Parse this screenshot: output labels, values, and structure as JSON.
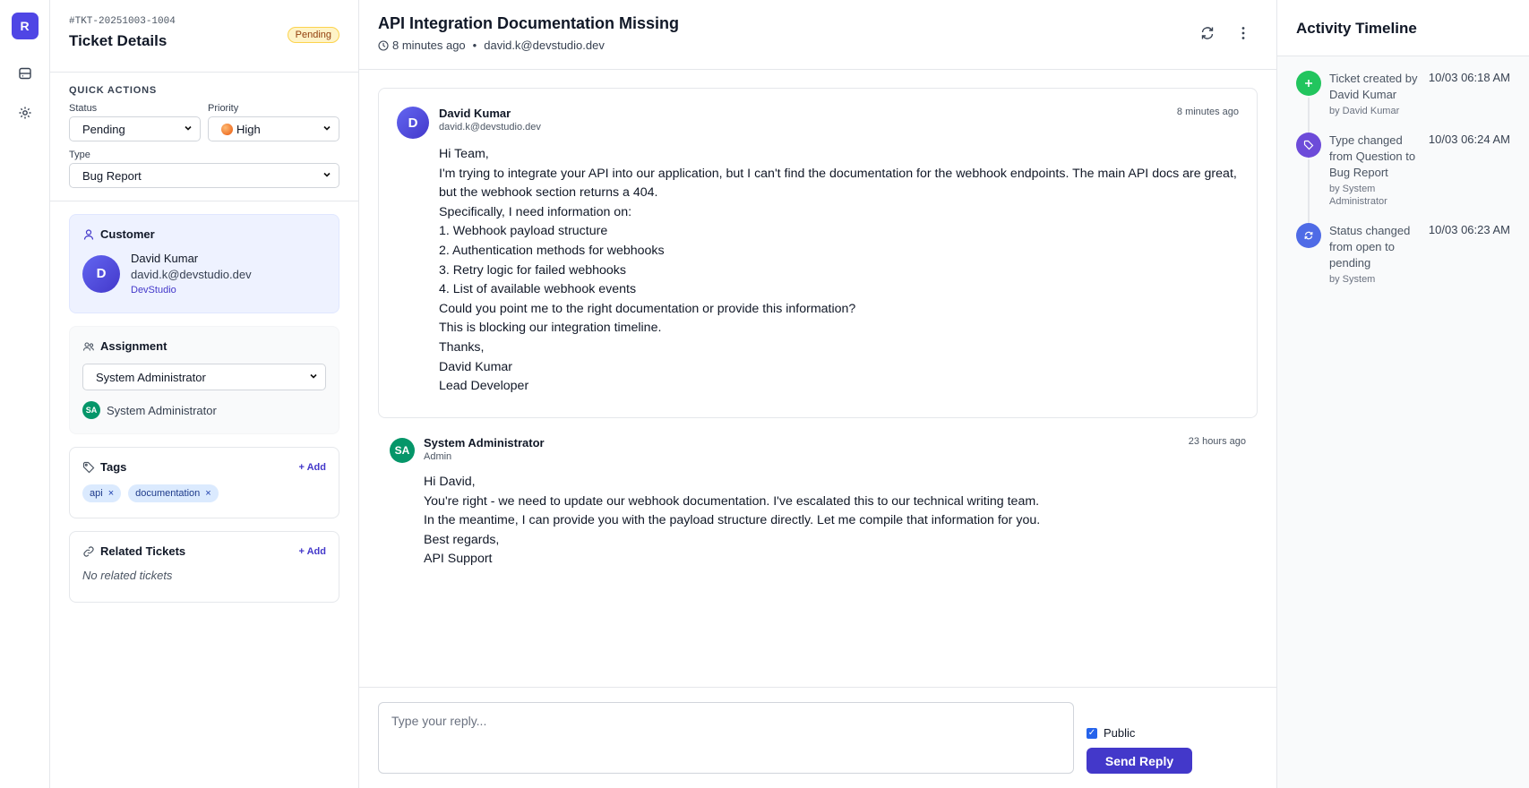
{
  "rail": {
    "logo_letter": "R"
  },
  "details": {
    "ticket_id": "#TKT-20251003-1004",
    "title": "Ticket Details",
    "status_badge": "Pending",
    "quick_actions": {
      "title": "QUICK ACTIONS",
      "status_label": "Status",
      "status_value": "Pending",
      "priority_label": "Priority",
      "priority_value": "High",
      "type_label": "Type",
      "type_value": "Bug Report"
    },
    "customer": {
      "title": "Customer",
      "avatar_letter": "D",
      "name": "David Kumar",
      "email": "david.k@devstudio.dev",
      "company": "DevStudio"
    },
    "assignment": {
      "title": "Assignment",
      "selected": "System Administrator",
      "assignee_initials": "SA",
      "assignee_name": "System Administrator"
    },
    "tags": {
      "title": "Tags",
      "add_label": "+ Add",
      "items": [
        "api",
        "documentation"
      ]
    },
    "related": {
      "title": "Related Tickets",
      "add_label": "+ Add",
      "empty": "No related tickets"
    }
  },
  "main": {
    "title": "API Integration Documentation Missing",
    "meta_time": "8 minutes ago",
    "meta_sep": "•",
    "meta_email": "david.k@devstudio.dev",
    "messages": [
      {
        "avatar": "D",
        "sender": "David Kumar",
        "sub": "david.k@devstudio.dev",
        "time": "8 minutes ago",
        "lines": [
          "Hi Team,",
          "I'm trying to integrate your API into our application, but I can't find the documentation for the webhook endpoints. The main API docs are great, but the webhook section returns a 404.",
          "Specifically, I need information on:",
          "1. Webhook payload structure",
          "2. Authentication methods for webhooks",
          "3. Retry logic for failed webhooks",
          "4. List of available webhook events",
          "Could you point me to the right documentation or provide this information?",
          "This is blocking our integration timeline.",
          "Thanks,",
          "David Kumar",
          "Lead Developer"
        ]
      },
      {
        "avatar": "SA",
        "sender": "System Administrator",
        "sub": "Admin",
        "time": "23 hours ago",
        "lines": [
          "Hi David,",
          "You're right - we need to update our webhook documentation. I've escalated this to our technical writing team.",
          "In the meantime, I can provide you with the payload structure directly. Let me compile that information for you.",
          "Best regards,",
          "API Support"
        ]
      }
    ],
    "reply": {
      "placeholder": "Type your reply...",
      "public_label": "Public",
      "send_label": "Send Reply"
    }
  },
  "timeline": {
    "title": "Activity Timeline",
    "items": [
      {
        "icon": "plus-icon",
        "color": "#22c55e",
        "desc": "Ticket created by David Kumar",
        "by": "by David Kumar",
        "time": "10/03 06:18 AM"
      },
      {
        "icon": "tag-icon",
        "color": "#6d4bd9",
        "desc": "Type changed from Question to Bug Report",
        "by": "by System Administrator",
        "time": "10/03 06:24 AM"
      },
      {
        "icon": "refresh-icon",
        "color": "#4f6be6",
        "desc": "Status changed from open to pending",
        "by": "by System",
        "time": "10/03 06:23 AM"
      }
    ]
  },
  "colors": {
    "brand": "#4338ca",
    "pending_bg": "#fef3c7",
    "customer_bg": "#eef2ff",
    "tag_bg": "#dbeafe",
    "admin_avatar": "#059669"
  }
}
